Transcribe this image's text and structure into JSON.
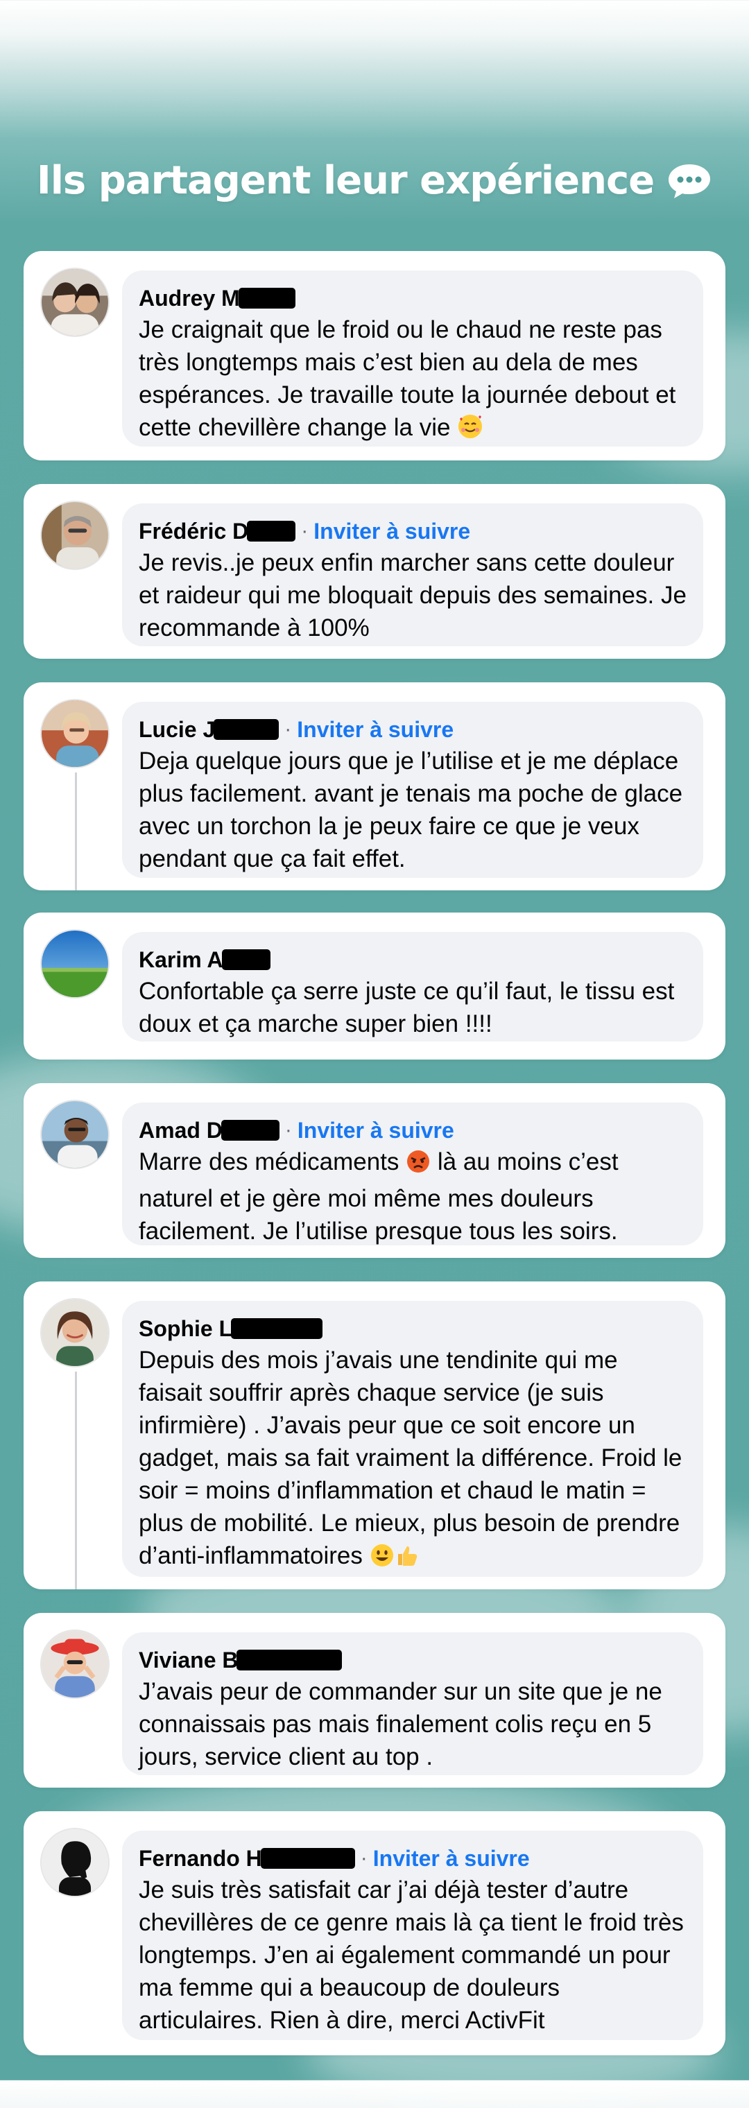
{
  "header": {
    "title": "Ils partagent leur expérience",
    "icon": "speech-bubble-icon"
  },
  "reviews": [
    {
      "name": "Audrey M",
      "follow": "",
      "text": "Je craignait que le froid ou le chaud ne reste pas très longtemps mais c’est bien au dela de mes espérances. Je travaille toute la journée debout et cette chevillère change la vie",
      "emoji": "smiling-face-with-hearts-emoji"
    },
    {
      "name": "Frédéric D",
      "follow": "Inviter à suivre",
      "text": "Je revis..je peux enfin marcher sans cette douleur et raideur qui me bloquait depuis des semaines. Je recommande à 100%",
      "emoji": ""
    },
    {
      "name": "Lucie J",
      "follow": "Inviter à suivre",
      "text": "Deja quelque jours que je l’utilise et je me déplace plus facilement. avant je tenais ma poche de glace avec un torchon la je peux faire ce que je veux pendant que ça fait effet.",
      "emoji": ""
    },
    {
      "name": "Karim A",
      "follow": "",
      "text": "Confortable ça serre juste ce qu’il faut, le tissu est doux et ça marche super bien !!!!",
      "emoji": ""
    },
    {
      "name": "Amad D",
      "follow": "Inviter à suivre",
      "text_a": "Marre des médicaments",
      "text_b": "là au moins c’est naturel et je gère moi même mes douleurs facilement. Je l’utilise presque tous les soirs.",
      "emoji": "angry-face-emoji"
    },
    {
      "name": "Sophie L",
      "follow": "",
      "text": "Depuis des mois j’avais une tendinite qui me faisait souffrir après chaque service (je suis infirmière) . J’avais peur que ce soit encore un gadget, mais sa fait vraiment la différence. Froid le soir = moins d’inflammation et chaud le matin = plus de mobilité. Le mieux, plus besoin de prendre d’anti-inflammatoires",
      "emoji": "grinning-face-and-thumbs-up-emoji"
    },
    {
      "name": "Viviane B",
      "follow": "",
      "text": "J’avais peur de commander sur un site que je ne connaissais pas mais finalement colis reçu en 5 jours, service client au top .",
      "emoji": ""
    },
    {
      "name": "Fernando H",
      "follow": "Inviter à suivre",
      "text": "Je suis très satisfait car j’ai déjà tester d’autre chevillères de ce genre mais là ça tient le froid très longtemps. J’en ai également commandé un pour ma femme qui a beaucoup de douleurs articulaires. Rien à dire, merci ActivFit",
      "emoji": ""
    }
  ],
  "separator": "·",
  "colors": {
    "link": "#1877f2",
    "bubble": "#f0f2f5",
    "background": "#5aa6a2"
  }
}
